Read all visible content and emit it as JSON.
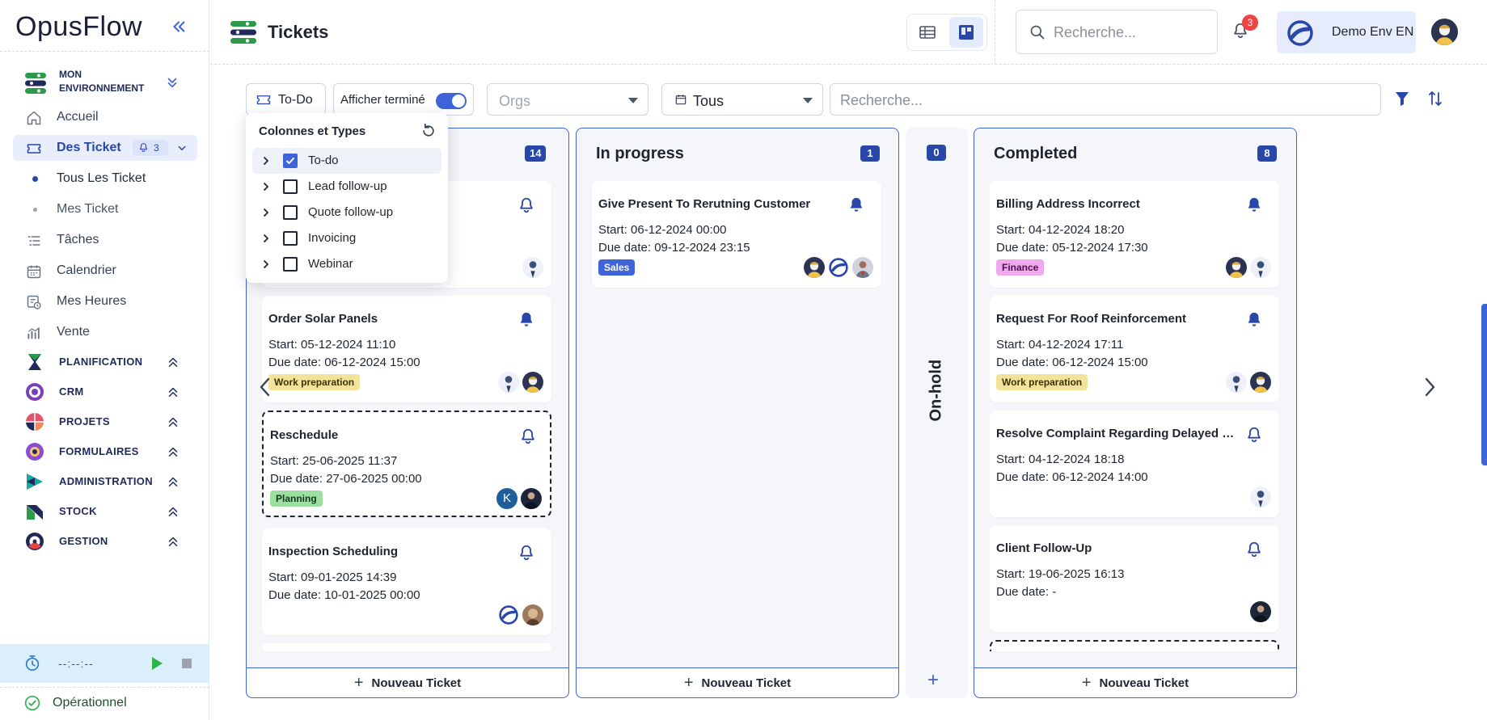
{
  "brand": {
    "logo_text": "OpusFlow",
    "accent": "#3f63d8",
    "dark_accent": "#2947a9"
  },
  "sidebar": {
    "environment_label": "MON ENVIRONNEMENT",
    "nav": [
      {
        "label": "Accueil",
        "icon": "home-icon"
      },
      {
        "label": "Des Ticket",
        "icon": "ticket-icon",
        "badge": "3",
        "active": true
      },
      {
        "label": "Tâches",
        "icon": "tasks-icon"
      },
      {
        "label": "Calendrier",
        "icon": "calendar-icon"
      },
      {
        "label": "Mes Heures",
        "icon": "hours-icon"
      },
      {
        "label": "Vente",
        "icon": "sales-chart-icon"
      }
    ],
    "sub_items": [
      {
        "label": "Tous Les Ticket",
        "active": true
      },
      {
        "label": "Mes Ticket",
        "active": false
      }
    ],
    "sections": [
      {
        "label": "PLANIFICATION",
        "color": "#1f2a5a"
      },
      {
        "label": "CRM",
        "color": "#7b3fb8"
      },
      {
        "label": "PROJETS",
        "color": "#e2556b"
      },
      {
        "label": "FORMULAIRES",
        "color": "#8a4fd0"
      },
      {
        "label": "ADMINISTRATION",
        "color": "#1aa7a0"
      },
      {
        "label": "STOCK",
        "color": "#1f2a5a"
      },
      {
        "label": "GESTION",
        "color": "#e04848"
      }
    ],
    "timer": {
      "value": "--:--:--"
    },
    "status": {
      "label": "Opérationnel"
    }
  },
  "header": {
    "title": "Tickets",
    "search_placeholder": "Recherche...",
    "notification_count": "3",
    "environment_name": "Demo Env EN"
  },
  "filters": {
    "type_chip": "To-Do",
    "show_done_label": "Afficher terminé",
    "orgs_placeholder": "Orgs",
    "period_value": "Tous",
    "search_placeholder": "Recherche..."
  },
  "dropdown": {
    "title": "Colonnes et Types",
    "items": [
      {
        "label": "To-do",
        "checked": true
      },
      {
        "label": "Lead follow-up",
        "checked": false
      },
      {
        "label": "Quote follow-up",
        "checked": false
      },
      {
        "label": "Invoicing",
        "checked": false
      },
      {
        "label": "Webinar",
        "checked": false
      }
    ]
  },
  "columns": {
    "todo": {
      "count": "14",
      "new_label": "Nouveau Ticket",
      "cards": [
        {
          "title": "Order Solar Panels",
          "start": "Start: 05-12-2024 11:10",
          "due": "Due date: 06-12-2024 15:00",
          "tag": "Work preparation",
          "tag_color": "#f3e39a"
        },
        {
          "title": "Reschedule",
          "start": "Start: 25-06-2025 11:37",
          "due": "Due date: 27-06-2025 00:00",
          "tag": "Planning",
          "tag_color": "#9be0a0",
          "avatar_letter": "K"
        },
        {
          "title": "Inspection Scheduling",
          "start": "Start: 09-01-2025 14:39",
          "due": "Due date: 10-01-2025 00:00"
        }
      ]
    },
    "in_progress": {
      "title": "In progress",
      "count": "1",
      "new_label": "Nouveau Ticket",
      "cards": [
        {
          "title": "Give Present To Rerutning Customer",
          "start": "Start: 06-12-2024 00:00",
          "due": "Due date: 09-12-2024 23:15",
          "tag": "Sales",
          "tag_color": "#3f63d8"
        }
      ]
    },
    "on_hold": {
      "title": "On-hold",
      "count": "0"
    },
    "completed": {
      "title": "Completed",
      "count": "8",
      "new_label": "Nouveau Ticket",
      "cards": [
        {
          "title": "Billing Address Incorrect",
          "start": "Start: 04-12-2024 18:20",
          "due": "Due date: 05-12-2024 17:30",
          "tag": "Finance",
          "tag_color": "#f0a8ee"
        },
        {
          "title": "Request For Roof Reinforcement",
          "start": "Start: 04-12-2024 17:11",
          "due": "Due date: 06-12-2024 15:00",
          "tag": "Work preparation",
          "tag_color": "#f3e39a"
        },
        {
          "title": "Resolve Complaint Regarding Delayed Service",
          "start": "Start: 04-12-2024 18:18",
          "due": "Due date: 06-12-2024 14:00"
        },
        {
          "title": "Client Follow-Up",
          "start": "Start: 19-06-2025 16:13",
          "due": "Due date: -"
        }
      ]
    }
  }
}
